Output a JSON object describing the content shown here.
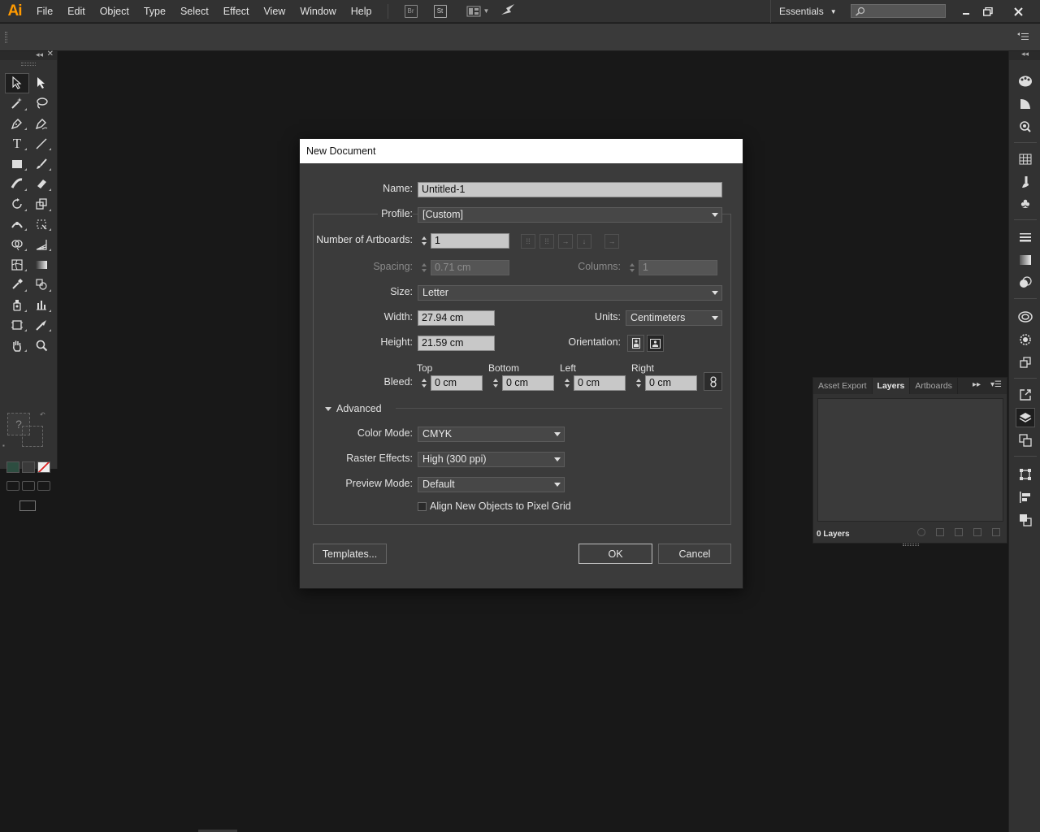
{
  "app": {
    "logo": "Ai",
    "menu": [
      "File",
      "Edit",
      "Object",
      "Type",
      "Select",
      "Effect",
      "View",
      "Window",
      "Help"
    ],
    "bridge_icon": "Br",
    "stock_icon": "St",
    "workspace": "Essentials",
    "search_placeholder": "",
    "window_controls": [
      "minimize",
      "restore",
      "close"
    ]
  },
  "tools": [
    "selection-tool",
    "direct-selection-tool",
    "magic-wand-tool",
    "lasso-tool",
    "pen-tool",
    "curvature-tool",
    "type-tool",
    "line-segment-tool",
    "rectangle-tool",
    "paintbrush-tool",
    "shaper-tool",
    "eraser-tool",
    "rotate-tool",
    "scale-tool",
    "width-tool",
    "free-transform-tool",
    "shape-builder-tool",
    "perspective-grid-tool",
    "mesh-tool",
    "gradient-tool",
    "eyedropper-tool",
    "blend-tool",
    "symbol-sprayer-tool",
    "column-graph-tool",
    "artboard-tool",
    "slice-tool",
    "hand-tool",
    "zoom-tool"
  ],
  "dock_icons": [
    "color-guide-icon",
    "color-icon",
    "appearance-icon",
    "swatches-icon",
    "brushes-icon",
    "symbols-icon",
    "stroke-icon",
    "gradient-icon",
    "transparency-icon",
    "libraries-icon",
    "graphic-styles-icon",
    "image-trace-icon",
    "asset-export-icon",
    "layers-icon",
    "artboards-icon",
    "transform-icon",
    "align-icon",
    "pathfinder-icon"
  ],
  "layers_panel": {
    "tabs": [
      "Asset Export",
      "Layers",
      "Artboards"
    ],
    "active_tab": "Layers",
    "count": "0 Layers"
  },
  "dialog": {
    "title": "New Document",
    "name_label": "Name:",
    "name_value": "Untitled-1",
    "profile_label": "Profile:",
    "profile_value": "[Custom]",
    "artboards_label": "Number of Artboards:",
    "artboards_value": "1",
    "spacing_label": "Spacing:",
    "spacing_value": "0.71 cm",
    "columns_label": "Columns:",
    "columns_value": "1",
    "size_label": "Size:",
    "size_value": "Letter",
    "width_label": "Width:",
    "width_value": "27.94 cm",
    "units_label": "Units:",
    "units_value": "Centimeters",
    "height_label": "Height:",
    "height_value": "21.59 cm",
    "orientation_label": "Orientation:",
    "bleed_label": "Bleed:",
    "bleed_top_label": "Top",
    "bleed_bottom_label": "Bottom",
    "bleed_left_label": "Left",
    "bleed_right_label": "Right",
    "bleed_top": "0 cm",
    "bleed_bottom": "0 cm",
    "bleed_left": "0 cm",
    "bleed_right": "0 cm",
    "advanced_label": "Advanced",
    "color_mode_label": "Color Mode:",
    "color_mode_value": "CMYK",
    "raster_label": "Raster Effects:",
    "raster_value": "High (300 ppi)",
    "preview_label": "Preview Mode:",
    "preview_value": "Default",
    "pixel_grid_label": "Align New Objects to Pixel Grid",
    "pixel_grid_checked": false,
    "templates_button": "Templates...",
    "ok_button": "OK",
    "cancel_button": "Cancel"
  },
  "colors": {
    "accent_logo": "#ff9a00",
    "background": "#181818",
    "panel": "#323232"
  }
}
